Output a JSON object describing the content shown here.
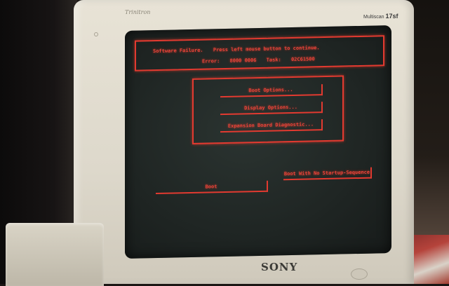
{
  "monitor": {
    "brand": "SONY",
    "series": "Trinitron",
    "model_prefix": "Multiscan",
    "model_number": "17sf"
  },
  "alert": {
    "title": "Software Failure.",
    "instruction": "Press left mouse button to continue.",
    "error_label": "Error:",
    "error_code": "8000 0006",
    "task_label": "Task:",
    "task_code": "02C61500"
  },
  "options": [
    {
      "label": "Boot Options..."
    },
    {
      "label": "Display Options..."
    },
    {
      "label": "Expansion Board Diagnostic..."
    }
  ],
  "bottom_buttons": {
    "boot": "Boot",
    "boot_no_startup": "Boot With No Startup-Sequence"
  },
  "colors": {
    "screen_text": "#e8443a",
    "screen_background": "#232a28",
    "bezel": "#e1dccf"
  }
}
